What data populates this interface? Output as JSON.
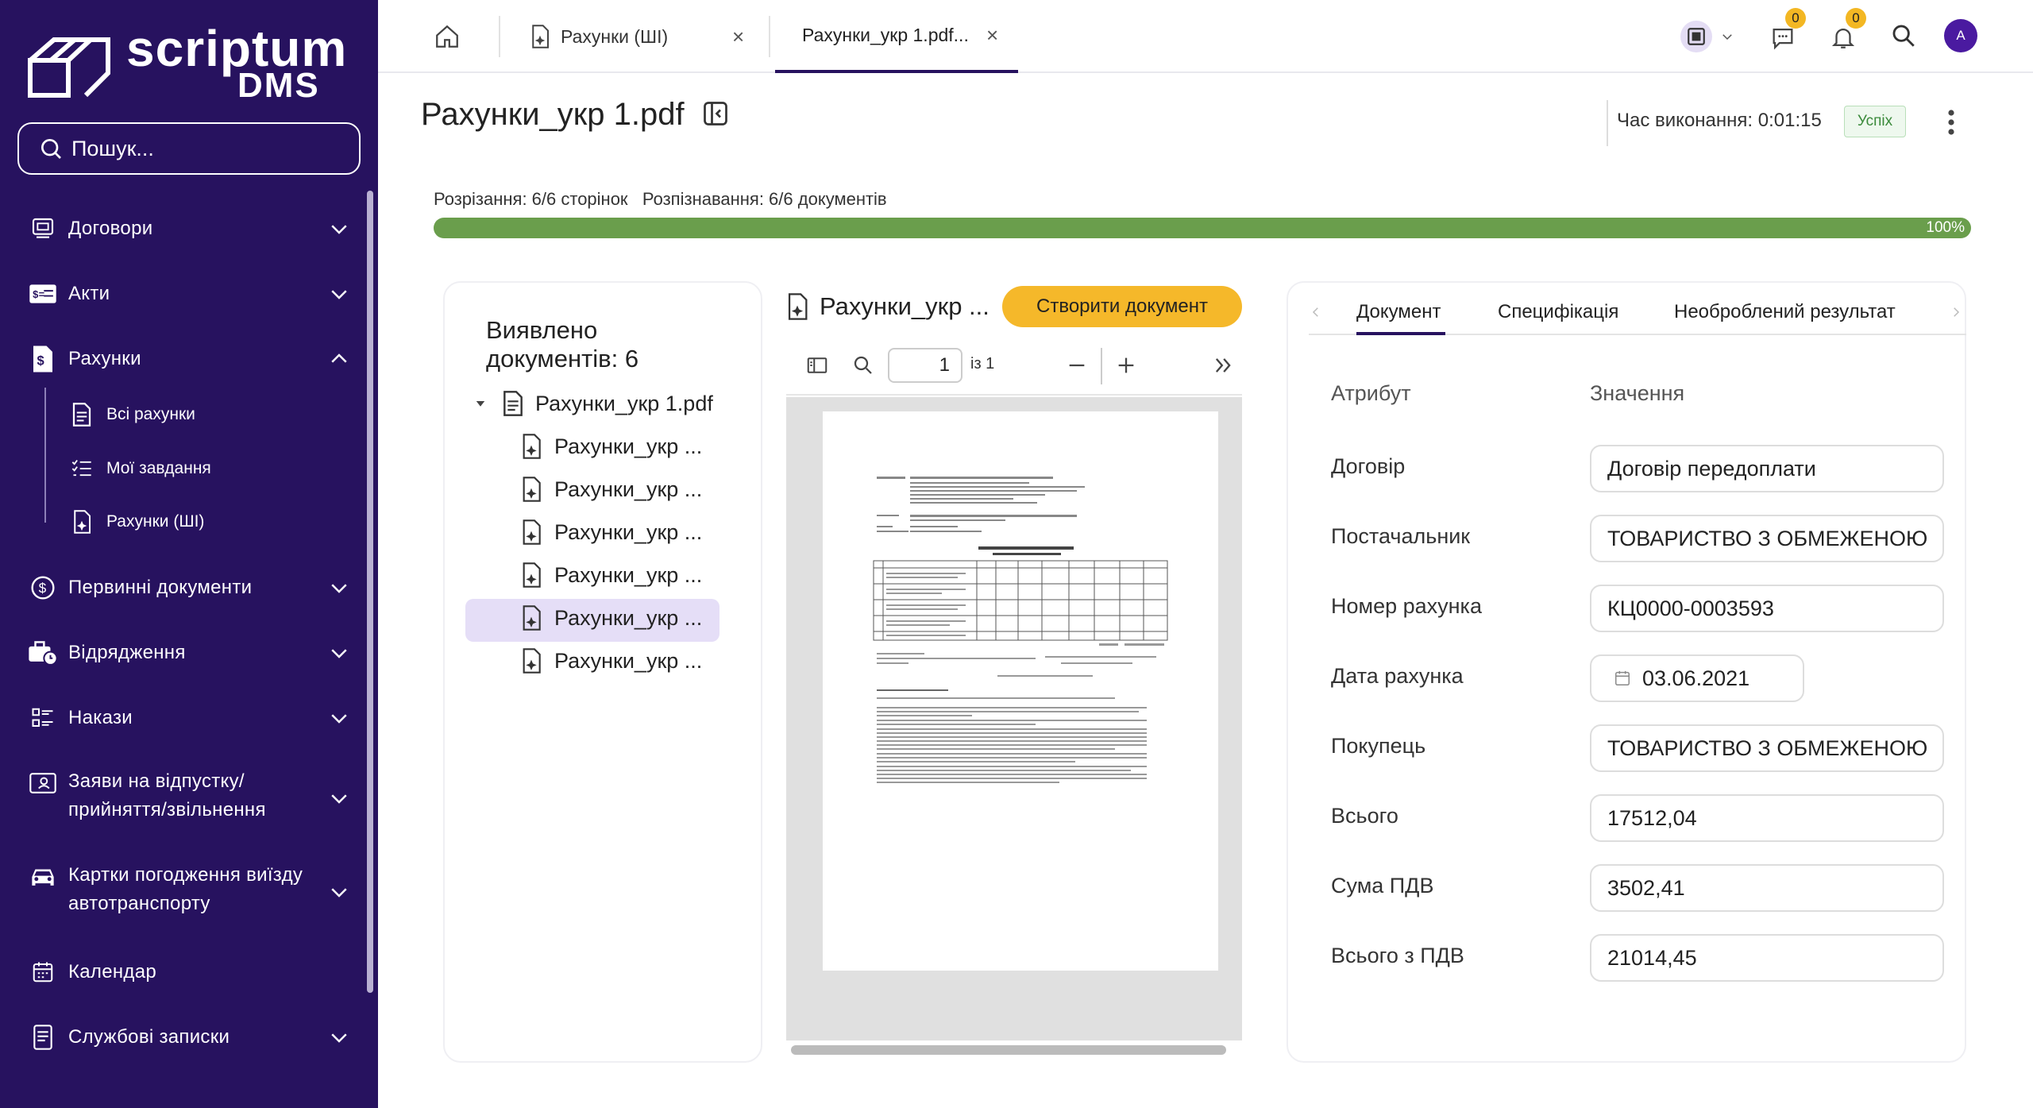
{
  "sidebar": {
    "logo_word": "scriptum",
    "logo_sub": "DMS",
    "search_placeholder": "Пошук...",
    "items": [
      {
        "label": "Договори"
      },
      {
        "label": "Акти"
      },
      {
        "label": "Рахунки"
      },
      {
        "label": "Первинні документи"
      },
      {
        "label": "Відрядження"
      },
      {
        "label": "Накази"
      },
      {
        "label": "Заяви на відпустку/ прийняття/звільнення"
      },
      {
        "label": "Картки погодження виїзду автотранспорту"
      },
      {
        "label": "Календар"
      },
      {
        "label": "Службові записки"
      }
    ],
    "subitems": [
      {
        "label": "Всі рахунки"
      },
      {
        "label": "Мої завдання"
      },
      {
        "label": "Рахунки (ШІ)"
      }
    ]
  },
  "tabs": [
    {
      "label": "Рахунки (ШІ)"
    },
    {
      "label": "Рахунки_укр 1.pdf..."
    }
  ],
  "badges": {
    "comments": "0",
    "notifications": "0"
  },
  "avatar": "A",
  "header": {
    "title": "Рахунки_укр 1.pdf",
    "exec_time": "Час виконання: 0:01:15",
    "status": "Успіх"
  },
  "progress": {
    "text": "Розрізання: 6/6 сторінок   Розпізнавання: 6/6 документів",
    "label": "100%",
    "value": 1.0
  },
  "docs": {
    "title": "Виявлено документів: 6",
    "root": "Рахунки_укр 1.pdf",
    "children": [
      "Рахунки_укр ...",
      "Рахунки_укр ...",
      "Рахунки_укр ...",
      "Рахунки_укр ...",
      "Рахунки_укр ...",
      "Рахунки_укр ..."
    ],
    "selected_index": 4
  },
  "viewer": {
    "title": "Рахунки_укр ...",
    "create_button": "Створити документ",
    "page_value": "1",
    "page_of": "із 1"
  },
  "right": {
    "tabs": [
      "Документ",
      "Специфікація",
      "Необроблений результат"
    ],
    "active_tab": 0,
    "col_attr": "Атрибут",
    "col_value": "Значення",
    "fields": [
      {
        "label": "Договір",
        "value": "Договір передоплати"
      },
      {
        "label": "Постачальник",
        "value": "ТОВАРИСТВО З ОБМЕЖЕНОЮ"
      },
      {
        "label": "Номер рахунка",
        "value": "КЦ0000-0003593"
      },
      {
        "label": "Дата рахунка",
        "value": "03.06.2021"
      },
      {
        "label": "Покупець",
        "value": "ТОВАРИСТВО З ОБМЕЖЕНОЮ"
      },
      {
        "label": "Всього",
        "value": "17512,04"
      },
      {
        "label": "Сума ПДВ",
        "value": "3502,41"
      },
      {
        "label": "Всього з ПДВ",
        "value": "21014,45"
      }
    ]
  },
  "colors": {
    "sidebar": "#27125f",
    "accent": "#f5b82a",
    "progress": "#6a9e4c",
    "selected": "#e5def7"
  }
}
